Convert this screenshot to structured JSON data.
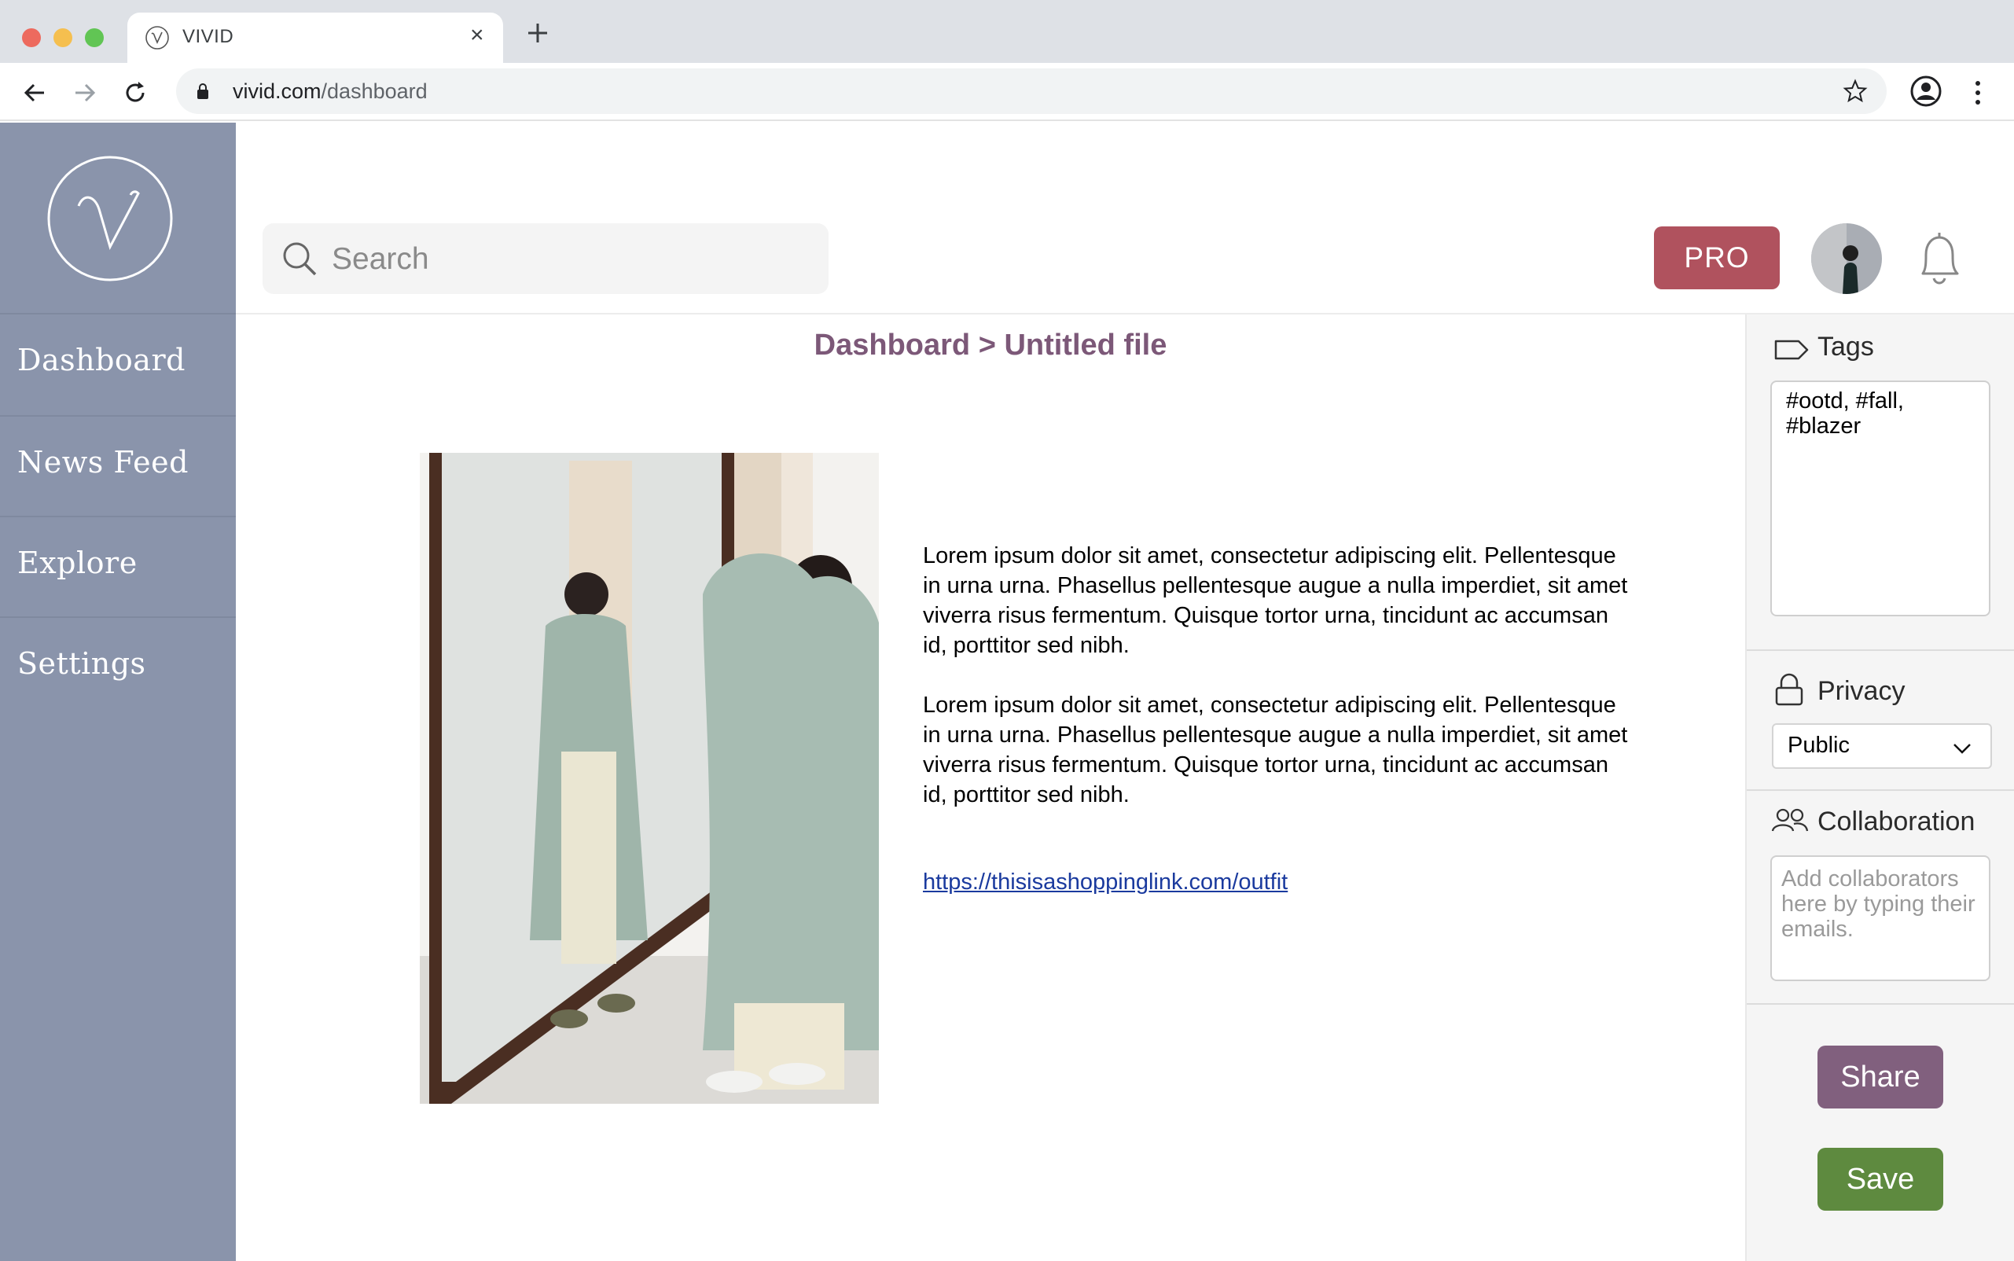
{
  "browser": {
    "tab_title": "VIVID",
    "url_host": "vivid.com",
    "url_path": "/dashboard",
    "icons": [
      "back-icon",
      "forward-icon",
      "reload-icon",
      "lock-icon",
      "star-icon",
      "profile-icon",
      "kebab-icon",
      "close-icon",
      "plus-icon"
    ]
  },
  "sidebar": {
    "logo_icon": "v-monogram-logo",
    "items": [
      {
        "label": "Dashboard"
      },
      {
        "label": "News Feed"
      },
      {
        "label": "Explore"
      },
      {
        "label": "Settings"
      }
    ]
  },
  "header": {
    "search_placeholder": "Search",
    "pro_label": "PRO"
  },
  "main": {
    "breadcrumb": "Dashboard > Untitled file",
    "paragraphs": [
      "Lorem ipsum dolor sit amet, consectetur adipiscing elit. Pellentesque in urna urna. Phasellus pellentesque augue a nulla imperdiet, sit amet viverra risus fermentum. Quisque tortor urna, tincidunt ac accumsan id, porttitor sed nibh.",
      "Lorem ipsum dolor sit amet, consectetur adipiscing elit. Pellentesque in urna urna. Phasellus pellentesque augue a nulla imperdiet, sit amet viverra risus fermentum. Quisque tortor urna, tincidunt ac accumsan id, porttitor sed nibh."
    ],
    "link": "https://thisisashoppinglink.com/outfit"
  },
  "panel": {
    "tags_label": "Tags",
    "tags_value": "#ootd, #fall, #blazer",
    "privacy_label": "Privacy",
    "privacy_value": "Public",
    "collab_label": "Collaboration",
    "collab_placeholder": "Add collaborators here by typing their emails.",
    "share_label": "Share",
    "save_label": "Save"
  },
  "colors": {
    "sidebar": "#8a94ab",
    "pro": "#b0525e",
    "breadcrumb": "#7c5878",
    "share": "#81607e",
    "save": "#5e8a3f",
    "link": "#1a3a9e"
  }
}
